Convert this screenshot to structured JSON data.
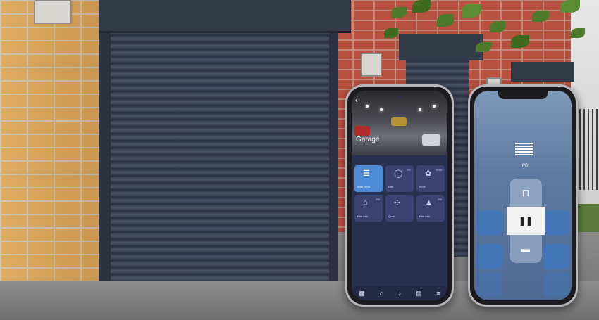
{
  "phone_left": {
    "room_title": "Garage",
    "back_icon": "chevron-left-icon",
    "tiles": [
      {
        "icon": "shutter-icon",
        "label": "Auto Door",
        "value": "",
        "active": true
      },
      {
        "icon": "bulb-icon",
        "label": "Đèn",
        "value": "0%",
        "active": false
      },
      {
        "icon": "palette-icon",
        "label": "RGB",
        "value": "RGB",
        "active": false
      },
      {
        "icon": "ceiling-light-icon",
        "label": "Đèn trần",
        "value": "0%",
        "active": false
      },
      {
        "icon": "fan-icon",
        "label": "Quạt",
        "value": "",
        "active": false
      },
      {
        "icon": "lamp-icon",
        "label": "Đèn trần",
        "value": "0%",
        "active": false
      }
    ],
    "tabbar": [
      "grid-icon",
      "home-icon",
      "music-icon",
      "card-icon",
      "menu-icon"
    ]
  },
  "phone_right": {
    "device_label": "Mở",
    "controls": [
      "open-icon",
      "pause-icon",
      "close-icon"
    ]
  },
  "colors": {
    "app_bg": "#28304f",
    "tile_bg": "#3a4270",
    "tile_active": "#4c8bd6",
    "shutter": "#333a48"
  }
}
